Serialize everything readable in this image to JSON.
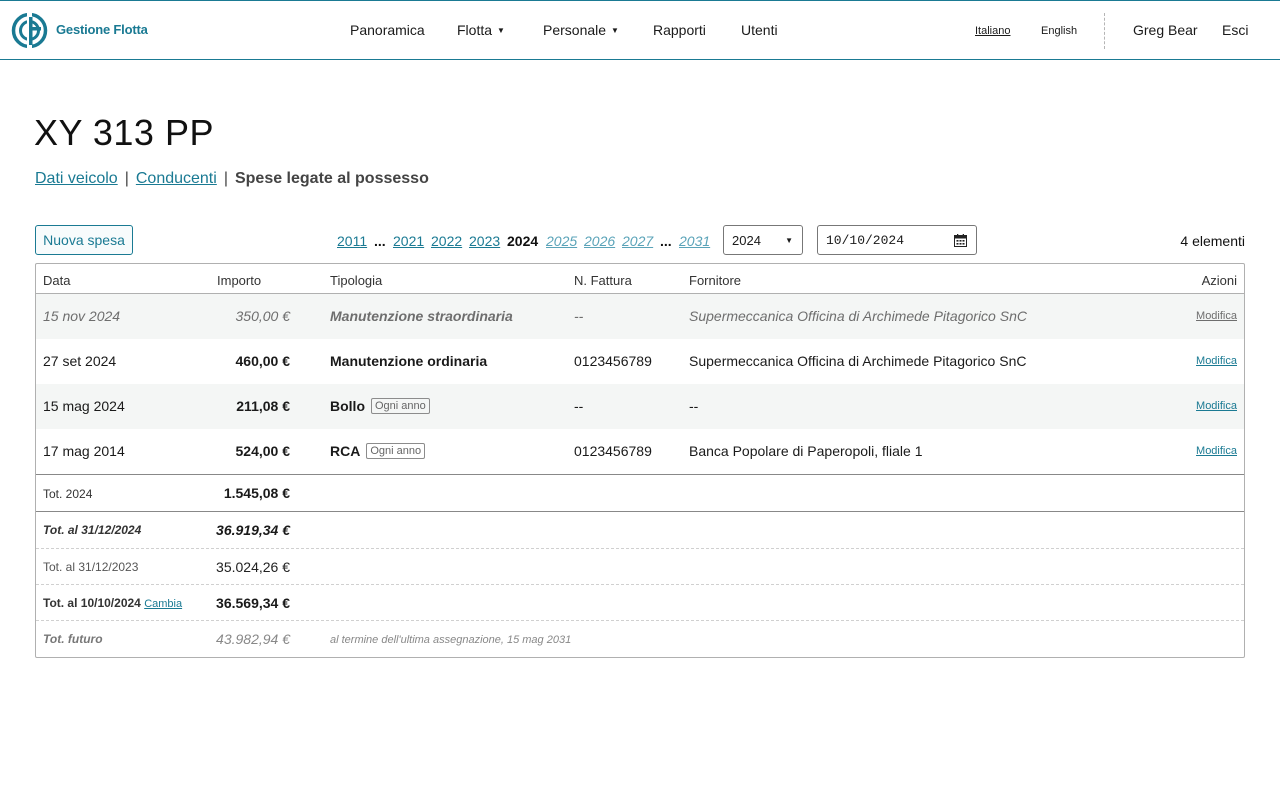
{
  "header": {
    "brand": "Gestione Flotta",
    "nav": [
      {
        "label": "Panoramica",
        "dropdown": false
      },
      {
        "label": "Flotta",
        "dropdown": true
      },
      {
        "label": "Personale",
        "dropdown": true
      },
      {
        "label": "Rapporti",
        "dropdown": false
      },
      {
        "label": "Utenti",
        "dropdown": false
      }
    ],
    "languages": [
      {
        "label": "Italiano",
        "active": true
      },
      {
        "label": "English",
        "active": false
      }
    ],
    "user": "Greg Bear",
    "logout": "Esci"
  },
  "page": {
    "title": "XY 313 PP",
    "subnav": {
      "vehicle_data": "Dati veicolo",
      "drivers": "Conducenti",
      "separator": "|",
      "current": "Spese legate al possesso"
    }
  },
  "toolbar": {
    "new_button": "Nuova spesa",
    "years": [
      "2011",
      "...",
      "2021",
      "2022",
      "2023",
      "2024",
      "2025",
      "2026",
      "2027",
      "...",
      "2031"
    ],
    "year_select": "2024",
    "date": "10/10/2024",
    "count": "4 elementi"
  },
  "table": {
    "headers": [
      "Data",
      "Importo",
      "Tipologia",
      "N. Fattura",
      "Fornitore",
      "Azioni"
    ],
    "rows": [
      {
        "date": "15 nov 2024",
        "amount": "350,00 €",
        "type": "Manutenzione straordinaria",
        "tag": "",
        "invoice": "--",
        "supplier": "Supermeccanica Officina di Archimede Pitagorico SnC",
        "action": "Modifica"
      },
      {
        "date": "27 set 2024",
        "amount": "460,00 €",
        "type": "Manutenzione ordinaria",
        "tag": "",
        "invoice": "0123456789",
        "supplier": "Supermeccanica Officina di Archimede Pitagorico SnC",
        "action": "Modifica"
      },
      {
        "date": "15 mag 2024",
        "amount": "211,08 €",
        "type": "Bollo",
        "tag": "Ogni anno",
        "invoice": "--",
        "supplier": "--",
        "action": "Modifica"
      },
      {
        "date": "17 mag 2014",
        "amount": "524,00 €",
        "type": "RCA",
        "tag": "Ogni anno",
        "invoice": "0123456789",
        "supplier": "Banca Popolare di Paperopoli, fliale 1",
        "action": "Modifica"
      }
    ],
    "totals": {
      "year_label": "Tot. 2024",
      "year_value": "1.545,08 €",
      "end_year_label": "Tot. al 31/12/2024",
      "end_year_value": "36.919,34 €",
      "prev_year_label": "Tot. al 31/12/2023",
      "prev_year_value": "35.024,26 €",
      "date_label": "Tot. al 10/10/2024",
      "date_change": "Cambia",
      "date_value": "36.569,34 €",
      "future_label": "Tot. futuro",
      "future_value": "43.982,94 €",
      "future_note": "al termine dell'ultima assegnazione, 15 mag 2031"
    }
  }
}
